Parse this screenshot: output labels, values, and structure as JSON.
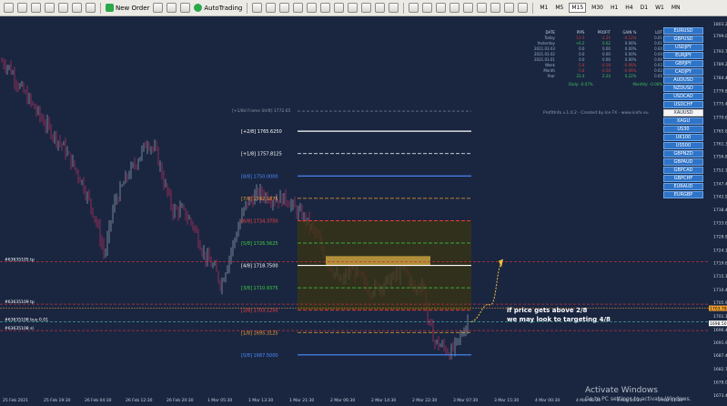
{
  "toolbar": {
    "new_order": "New Order",
    "autotrading": "AutoTrading",
    "timeframes": [
      "M1",
      "M5",
      "M15",
      "M30",
      "H1",
      "H4",
      "D1",
      "W1",
      "MN"
    ],
    "active_timeframe": "M15"
  },
  "price_axis": {
    "labels": [
      "1803.20",
      "1799.00",
      "1793.70",
      "1789.20",
      "1784.45",
      "1779.85",
      "1775.40",
      "1770.60",
      "1765.85",
      "1761.35",
      "1756.85",
      "1752.10",
      "1747.40",
      "1742.90",
      "1738.40",
      "1733.65",
      "1728.90",
      "1724.15",
      "1719.65",
      "1715.15",
      "1710.40",
      "1705.90",
      "1701.15",
      "1696.40",
      "1691.90",
      "1687.40",
      "1682.70",
      "1678.00",
      "1673.45"
    ],
    "current_price_tag": "1703.78",
    "current_price_tag2": "1698.50"
  },
  "time_axis": {
    "labels": [
      "25 Feb 2021",
      "25 Feb 19:30",
      "26 Feb 04:30",
      "26 Feb 12:30",
      "26 Feb 20:30",
      "1 Mar 05:30",
      "1 Mar 13:30",
      "1 Mar 21:30",
      "2 Mar 06:30",
      "2 Mar 14:30",
      "2 Mar 22:30",
      "3 Mar 07:30",
      "3 Mar 15:30",
      "4 Mar 00:30",
      "4 Mar 08:30",
      "4 Mar 16:30",
      "5 Mar 01:30"
    ]
  },
  "murrey": {
    "frame_shift": "[+1/8d Frame Shift]  1772.65",
    "levels": [
      {
        "label": "[+2/8]",
        "price": "1765.6250",
        "color": "#ffffff"
      },
      {
        "label": "[+1/8]",
        "price": "1757.8125",
        "color": "#ffffff"
      },
      {
        "label": "[8/8]",
        "price": "1750.0000",
        "color": "#4a8cff"
      },
      {
        "label": "[7/8]",
        "price": "1742.1875",
        "color": "#f0a030"
      },
      {
        "label": "[6/8]",
        "price": "1734.3750",
        "color": "#ff4040"
      },
      {
        "label": "[5/8]",
        "price": "1726.5625",
        "color": "#40d040"
      },
      {
        "label": "[4/8]",
        "price": "1718.7500",
        "color": "#ffffff"
      },
      {
        "label": "[3/8]",
        "price": "1710.9375",
        "color": "#40d040"
      },
      {
        "label": "[2/8]",
        "price": "1703.1250",
        "color": "#ff4040"
      },
      {
        "label": "[1/8]",
        "price": "1695.3125",
        "color": "#f0a030"
      },
      {
        "label": "[0/8]",
        "price": "1687.5000",
        "color": "#4a8cff"
      }
    ]
  },
  "order_lines": {
    "tp": "#63635105 tp",
    "tp2": "#63635109 tp",
    "buy": "#63635108 buy 0.01",
    "sl": "#63635108 sl"
  },
  "profit_info": {
    "headers": [
      "DATE",
      "PIPS",
      "PROFIT",
      "GAIN %",
      "LOT"
    ],
    "rows": [
      [
        "Today",
        "-12.0",
        "-1.20",
        "-0.12%",
        "0.01"
      ],
      [
        "Yesterday",
        "+6.2",
        "0.62",
        "0.06%",
        "0.01"
      ],
      [
        "2021.03.03",
        "0.0",
        "0.00",
        "0.00%",
        "0.00"
      ],
      [
        "2021.03.02",
        "0.0",
        "0.00",
        "0.00%",
        "0.00"
      ],
      [
        "2021.03.01",
        "0.0",
        "0.00",
        "0.00%",
        "0.00"
      ],
      [
        "Week",
        "-5.8",
        "-0.58",
        "-0.06%",
        "0.02"
      ],
      [
        "Month",
        "-5.8",
        "-0.58",
        "-0.06%",
        "0.02"
      ],
      [
        "Year",
        "22.4",
        "2.24",
        "0.22%",
        "0.05"
      ]
    ],
    "daily": "Daily: -0.07%",
    "monthly": "Monthly: -0.06%",
    "credit": "ProfitInfo v.1.0.2 - Created by Ice FX - www.icefx.eu"
  },
  "symbols": [
    "EURUSD",
    "GBPUSD",
    "USDJPY",
    "EURJPY",
    "GBPJPY",
    "CADJPY",
    "AUDUSD",
    "NZDUSD",
    "USDCAD",
    "USDCHF",
    "XAUUSD",
    "XAGU",
    "US30",
    "UK100",
    "US500",
    "GBPNZD",
    "GBPAUD",
    "GBPCAD",
    "GBPCHF",
    "EURAUD",
    "EURGBP"
  ],
  "selected_symbol": "XAUUSD",
  "annotation": [
    "if price gets above 2/8",
    "we may look to targeting 4/8"
  ],
  "watermark": [
    "Activate Windows",
    "Go to PC settings to activate Windows."
  ],
  "colors": {
    "background": "#1a2640",
    "bull": "#9aa8b8",
    "bear": "#c03060",
    "box": "#3a3410",
    "highlight": "#c8a040"
  }
}
